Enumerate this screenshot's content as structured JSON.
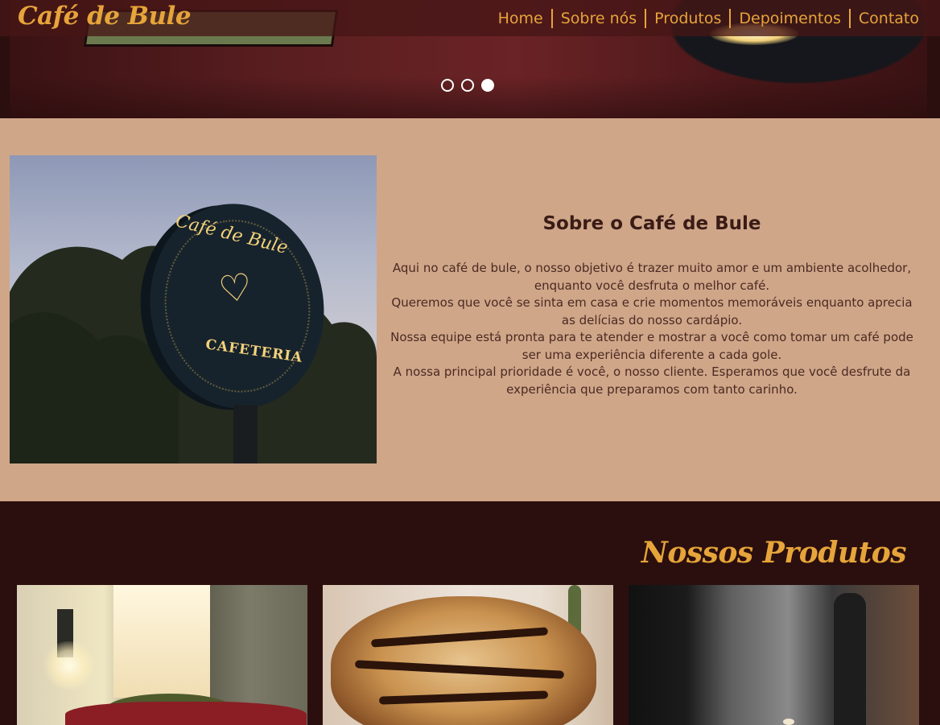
{
  "navbar": {
    "logo": "Café de Bule",
    "links": [
      "Home",
      "Sobre nós",
      "Produtos",
      "Depoimentos",
      "Contato"
    ]
  },
  "hero": {
    "slides_total": 3,
    "active_slide": 3
  },
  "about": {
    "title": "Sobre o Café de Bule",
    "paragraphs": [
      "Aqui no café de bule, o nosso objetivo é trazer muito amor e um ambiente acolhedor, enquanto você desfruta o melhor café.",
      "Queremos que você se sinta em casa e crie momentos memoráveis enquanto aprecia as delícias do nosso cardápio.",
      "Nossa equipe está pronta para te atender e mostrar a você como tomar um café pode ser uma experiência diferente a cada gole.",
      "A nossa principal prioridade é você, o nosso cliente. Esperamos que você desfrute da experiência que preparamos com tanto carinho."
    ],
    "sign": {
      "title": "Café de Bule",
      "subtitle": "CAFETERIA"
    }
  },
  "products": {
    "title": "Nossos Produtos"
  },
  "colors": {
    "accent": "#e6a43a",
    "dark_bg": "#2b0f0e",
    "about_bg": "#d0a689",
    "text": "#4a2a22"
  }
}
